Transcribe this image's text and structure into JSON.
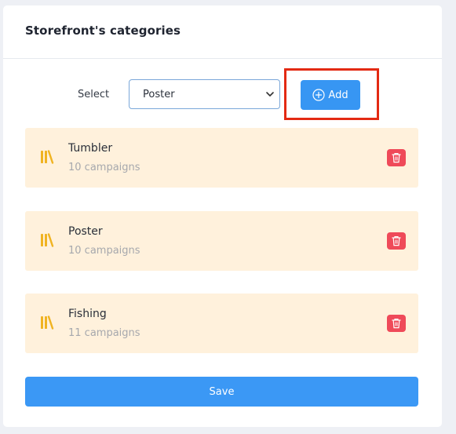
{
  "card": {
    "title": "Storefront's categories"
  },
  "form": {
    "select_label": "Select",
    "selected_value": "Poster",
    "add_label": "Add"
  },
  "categories": [
    {
      "name": "Tumbler",
      "count": "10 campaigns"
    },
    {
      "name": "Poster",
      "count": "10 campaigns"
    },
    {
      "name": "Fishing",
      "count": "11 campaigns"
    }
  ],
  "footer": {
    "save_label": "Save"
  },
  "colors": {
    "accent": "#3796f3",
    "row_background": "#fff1dc",
    "delete": "#ef4a59",
    "icon": "#f0b321",
    "highlight": "#e32a13"
  },
  "icons": {
    "add": "plus-circle-icon",
    "category": "books-icon",
    "delete": "trash-icon",
    "select": "chevron-down-icon"
  }
}
